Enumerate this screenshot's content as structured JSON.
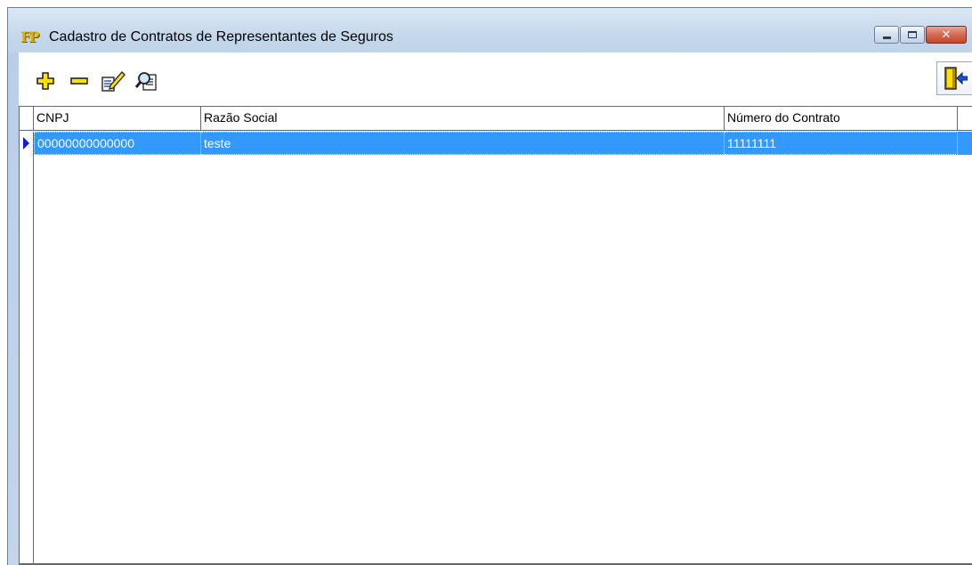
{
  "window": {
    "title": "Cadastro de Contratos de Representantes de Seguros",
    "logo_text": "FP",
    "caption_buttons": {
      "minimize": "minimize-icon",
      "maximize": "maximize-icon",
      "close": "close-icon",
      "close_glyph": "✕"
    }
  },
  "toolbar": {
    "buttons": [
      {
        "name": "add",
        "icon": "plus-icon"
      },
      {
        "name": "remove",
        "icon": "minus-icon"
      },
      {
        "name": "edit",
        "icon": "edit-icon"
      },
      {
        "name": "search",
        "icon": "search-icon"
      }
    ],
    "exit_icon": "exit-door-icon"
  },
  "grid": {
    "columns": [
      "CNPJ",
      "Razão Social",
      "Número do Contrato"
    ],
    "rows": [
      {
        "cnpj": "00000000000000",
        "razao_social": "teste",
        "numero_contrato": "11111111",
        "selected": true
      }
    ],
    "selection_color": "#3399ff",
    "indicator_color": "#0a1fd6"
  }
}
